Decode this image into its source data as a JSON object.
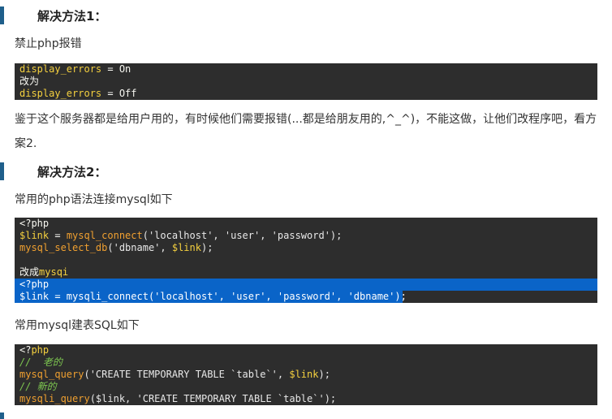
{
  "section1": {
    "heading": "解决方法1：",
    "desc": "禁止php报错",
    "code": {
      "line1_key": "display_errors",
      "line1_rest": " = On",
      "line2": "改为",
      "line3_key": "display_errors",
      "line3_rest": " = Off"
    },
    "note": "鉴于这个服务器都是给用户用的，有时候他们需要报错(...都是给朋友用的,^_^)，不能这做，让他们改程序吧，看方案2."
  },
  "section2": {
    "heading": "解决方法2：",
    "desc": "常用的php语法连接mysql如下",
    "code": {
      "l1": "<?php",
      "l2_var": "$link",
      "l2_eq": " = ",
      "l2_fn": "mysql_connect",
      "l2_args": "('localhost', 'user', 'password');",
      "l3_fn": "mysql_select_db",
      "l3_args1": "('dbname', ",
      "l3_var": "$link",
      "l3_end": ");",
      "l5_a": "改成",
      "l5_b": "mysqi",
      "l6": "<?php",
      "l7": "$link = mysqli_connect('localhost', 'user', 'password', 'dbname');"
    },
    "desc2": "常用mysql建表SQL如下",
    "code2": {
      "l1_a": "<?",
      "l1_b": "php",
      "l2": "//  老的",
      "l3_fn": "mysql_query",
      "l3_args": "('CREATE TEMPORARY TABLE `table`', ",
      "l3_var": "$link",
      "l3_end": ");",
      "l4": "// 新的",
      "l5_fn": "mysqli_query",
      "l5_args": "($link, 'CREATE TEMPORARY TABLE `table`');"
    }
  },
  "colors": {
    "accent_bar": "#1f5f8b",
    "code_bg": "#2d2d2d",
    "selection": "#0a64c8"
  }
}
